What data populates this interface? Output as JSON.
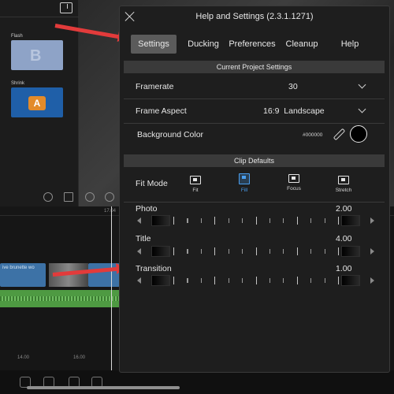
{
  "background": {
    "thumbnails": [
      {
        "label": "Flash",
        "letter": "B"
      },
      {
        "label": "Shrink",
        "letter": "A"
      }
    ],
    "ruler_labels": [
      "17.04",
      "14.00",
      "16.00"
    ],
    "clip_text": "ive brunette wo"
  },
  "panel": {
    "title": "Help and Settings (2.3.1.1271)",
    "tabs": [
      {
        "label": "Settings",
        "active": true
      },
      {
        "label": "Ducking",
        "active": false
      },
      {
        "label": "Preferences",
        "active": false
      },
      {
        "label": "Cleanup",
        "active": false
      },
      {
        "label": "Help",
        "active": false
      }
    ],
    "project_section": {
      "header": "Current Project Settings",
      "framerate": {
        "label": "Framerate",
        "value": "30"
      },
      "frame_aspect": {
        "label": "Frame Aspect",
        "value": "16:9  Landscape"
      },
      "background_color": {
        "label": "Background Color",
        "hex": "#000000",
        "color": "#000000"
      }
    },
    "clip_section": {
      "header": "Clip Defaults",
      "fit_mode": {
        "label": "Fit Mode",
        "options": [
          {
            "label": "Fit",
            "icon": "fit-icon",
            "selected": false
          },
          {
            "label": "Fill",
            "icon": "fill-icon",
            "selected": true
          },
          {
            "label": "Focus",
            "icon": "focus-icon",
            "selected": false
          },
          {
            "label": "Stretch",
            "icon": "stretch-icon",
            "selected": false
          }
        ]
      },
      "photo": {
        "label": "Photo",
        "value": "2.00"
      },
      "title": {
        "label": "Title",
        "value": "4.00"
      },
      "transition": {
        "label": "Transition",
        "value": "1.00"
      }
    }
  },
  "colors": {
    "accent": "#4a9ff0",
    "arrow": "#e23b3b",
    "panel_bg": "#1e1e1e"
  }
}
